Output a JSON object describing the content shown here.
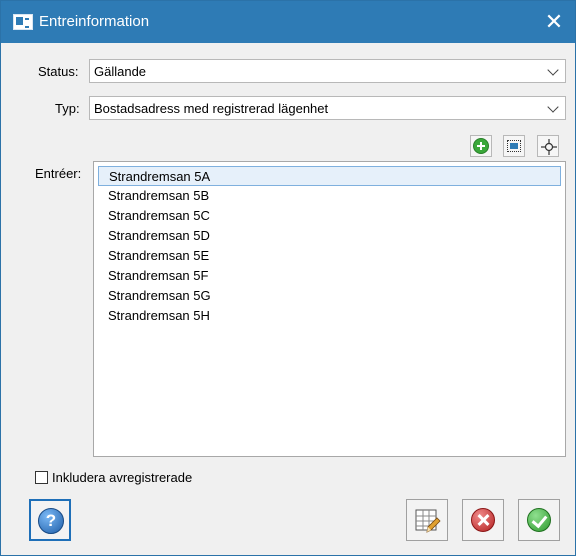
{
  "window": {
    "title": "Entreinformation",
    "close_glyph": "✕",
    "app_icon": "window-icon"
  },
  "status": {
    "label": "Status:",
    "value": "Gällande"
  },
  "typ": {
    "label": "Typ:",
    "value": "Bostadsadress med registrerad lägenhet"
  },
  "toolbar": {
    "add_icon": "add-circle-icon",
    "frame_icon": "frame-select-icon",
    "crosshair_icon": "crosshair-icon"
  },
  "entries": {
    "label": "Entréer:",
    "items": [
      "Strandremsan 5A",
      "Strandremsan 5B",
      "Strandremsan 5C",
      "Strandremsan 5D",
      "Strandremsan 5E",
      "Strandremsan 5F",
      "Strandremsan 5G",
      "Strandremsan 5H"
    ],
    "selected_index": 0
  },
  "include_deregistered": {
    "label": "Inkludera avregistrerade",
    "checked": false
  },
  "buttons": {
    "help_glyph": "?",
    "help_icon": "help-icon",
    "edit_icon": "table-edit-icon",
    "cancel_icon": "cancel-icon",
    "ok_icon": "ok-check-icon"
  },
  "colors": {
    "titlebar": "#2e7bb5",
    "selection_bg": "#e6f0fa",
    "selection_border": "#7fb0de"
  }
}
